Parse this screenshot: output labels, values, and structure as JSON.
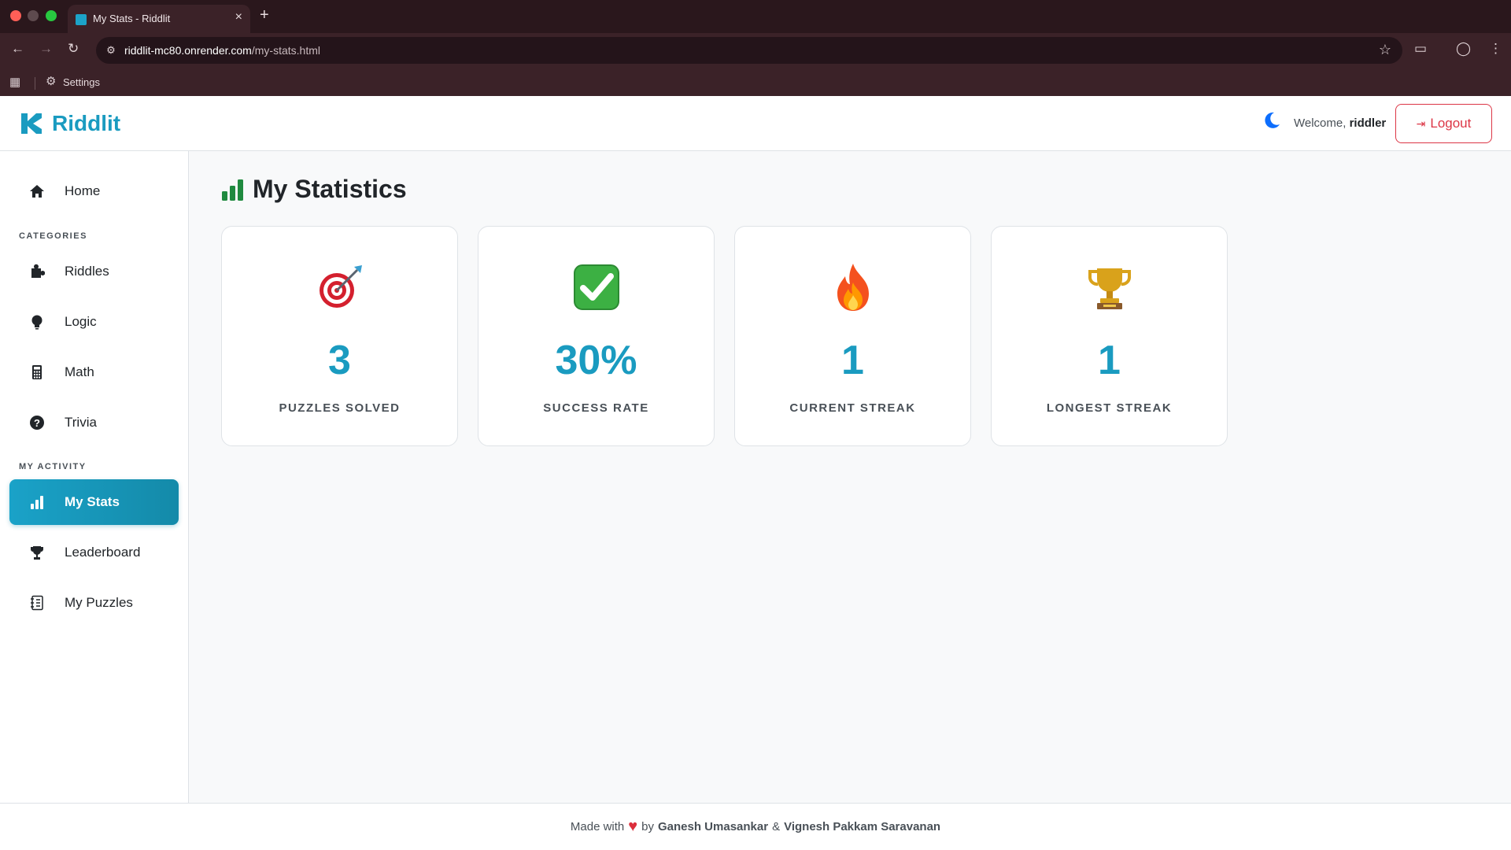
{
  "browser": {
    "tab_title": "My Stats - Riddlit",
    "url_domain": "riddlit-mc80.onrender.com",
    "url_path": "/my-stats.html",
    "bookmark_settings": "Settings"
  },
  "header": {
    "brand": "Riddlit",
    "welcome_prefix": "Welcome,",
    "username": "riddler",
    "logout_label": "Logout"
  },
  "sidebar": {
    "home": "Home",
    "categories_heading": "CATEGORIES",
    "riddles": "Riddles",
    "logic": "Logic",
    "math": "Math",
    "trivia": "Trivia",
    "activity_heading": "MY ACTIVITY",
    "my_stats": "My Stats",
    "leaderboard": "Leaderboard",
    "my_puzzles": "My Puzzles"
  },
  "main": {
    "title": "My Statistics",
    "cards": [
      {
        "icon": "target-icon",
        "value": "3",
        "label": "PUZZLES SOLVED"
      },
      {
        "icon": "check-icon",
        "value": "30%",
        "label": "SUCCESS RATE"
      },
      {
        "icon": "fire-icon",
        "value": "1",
        "label": "CURRENT STREAK"
      },
      {
        "icon": "trophy-icon",
        "value": "1",
        "label": "LONGEST STREAK"
      }
    ]
  },
  "footer": {
    "made_with": "Made with",
    "by": "by",
    "author1": "Ganesh Umasankar",
    "amp": "&",
    "author2": "Vignesh Pakkam Saravanan"
  },
  "colors": {
    "accent": "#1a9bc0",
    "danger": "#dc3545",
    "chart_icon": "#1f8a3f"
  }
}
